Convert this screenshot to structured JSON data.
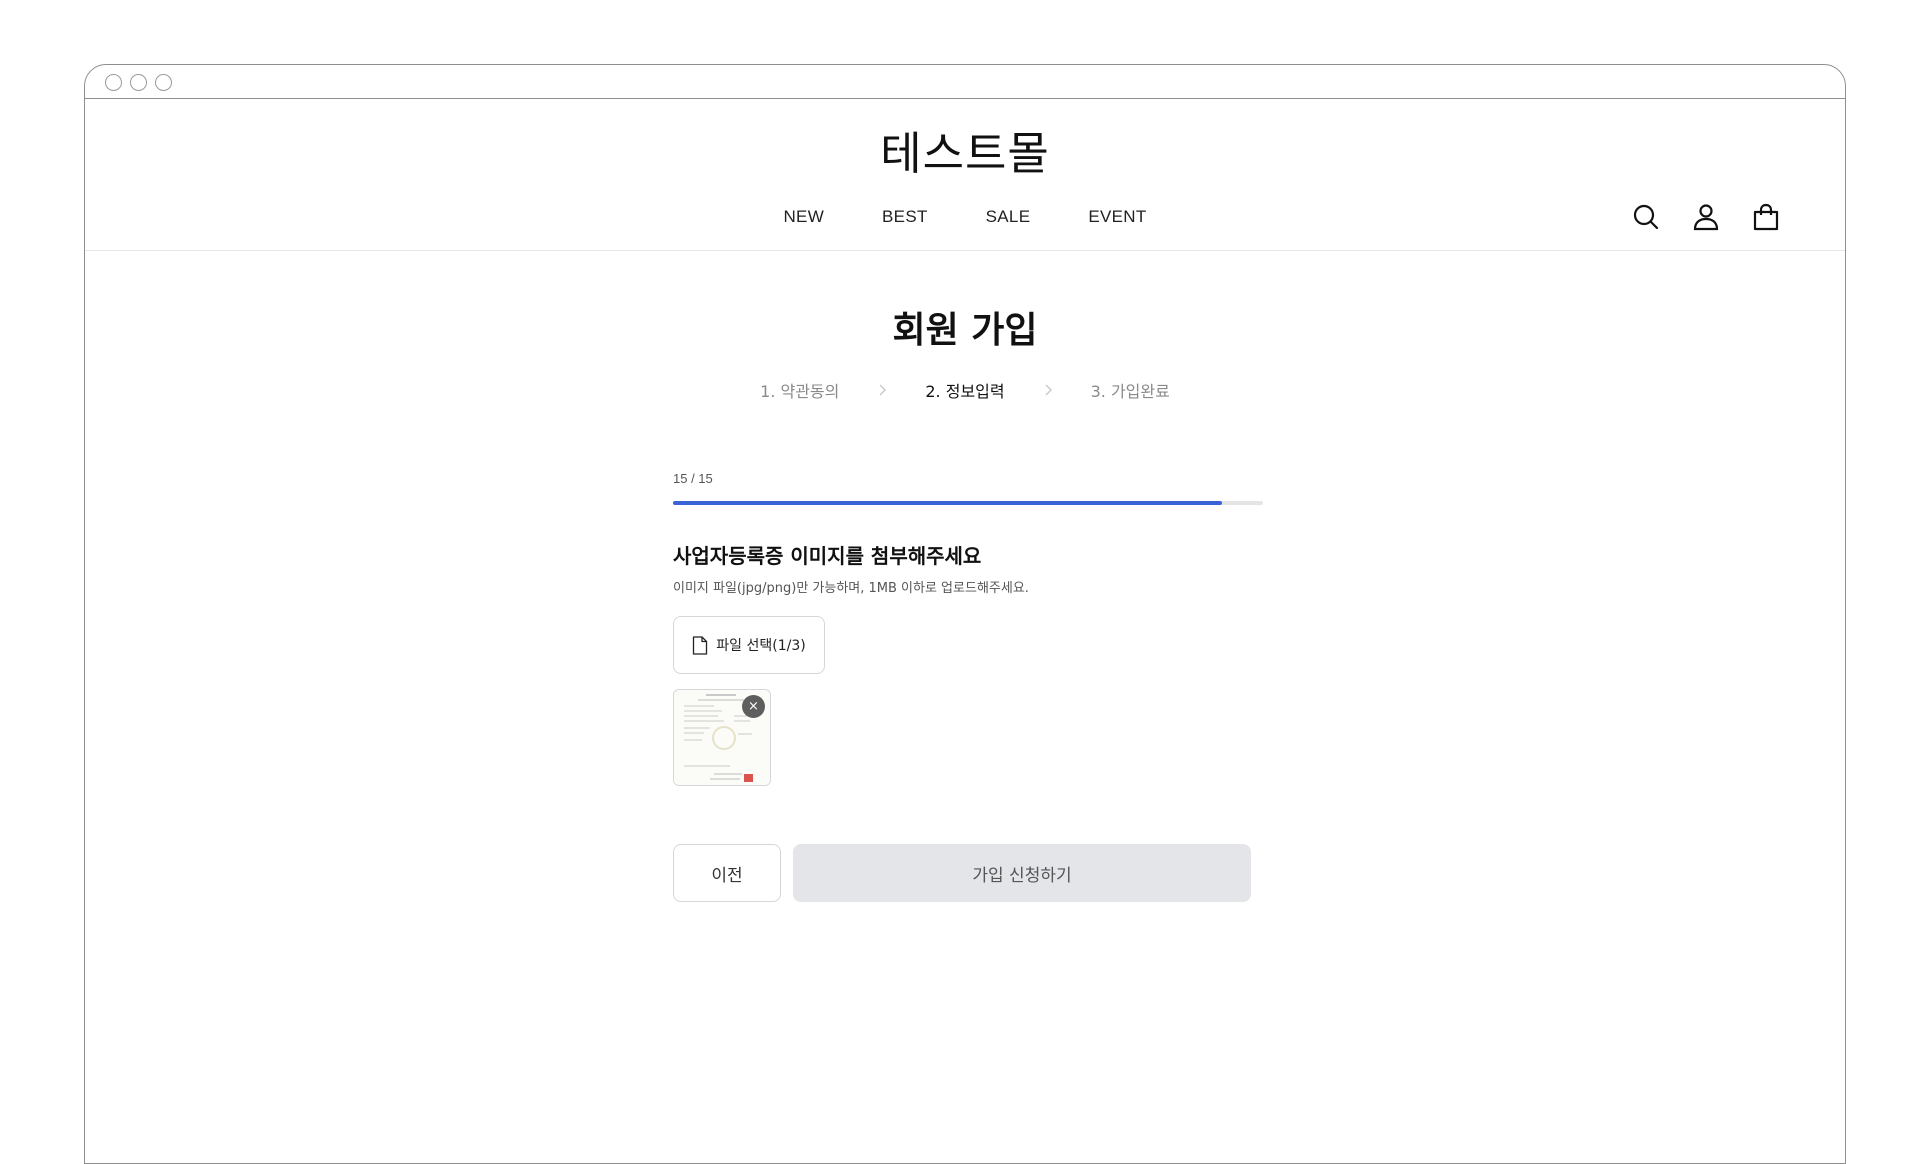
{
  "header": {
    "logo": "테스트몰",
    "nav": [
      {
        "label": "NEW"
      },
      {
        "label": "BEST"
      },
      {
        "label": "SALE"
      },
      {
        "label": "EVENT"
      }
    ],
    "icons": [
      "search-icon",
      "user-icon",
      "shopping-bag-icon"
    ]
  },
  "main": {
    "title": "회원 가입",
    "steps": [
      {
        "label": "1. 약관동의",
        "active": false
      },
      {
        "label": "2. 정보입력",
        "active": true
      },
      {
        "label": "3. 가입완료",
        "active": false
      }
    ],
    "progress": {
      "label": "15 / 15",
      "current": 15,
      "total": 15,
      "fill_fraction": 0.93,
      "color": "#3b63d8"
    },
    "question": "사업자등록증 이미지를 첨부해주세요",
    "hint": "이미지 파일(jpg/png)만 가능하며, 1MB 이하로 업로드해주세요.",
    "file_button_label": "파일 선택(1/3)",
    "remove_label": "×",
    "prev_button_label": "이전",
    "submit_button_label": "가입 신청하기"
  }
}
